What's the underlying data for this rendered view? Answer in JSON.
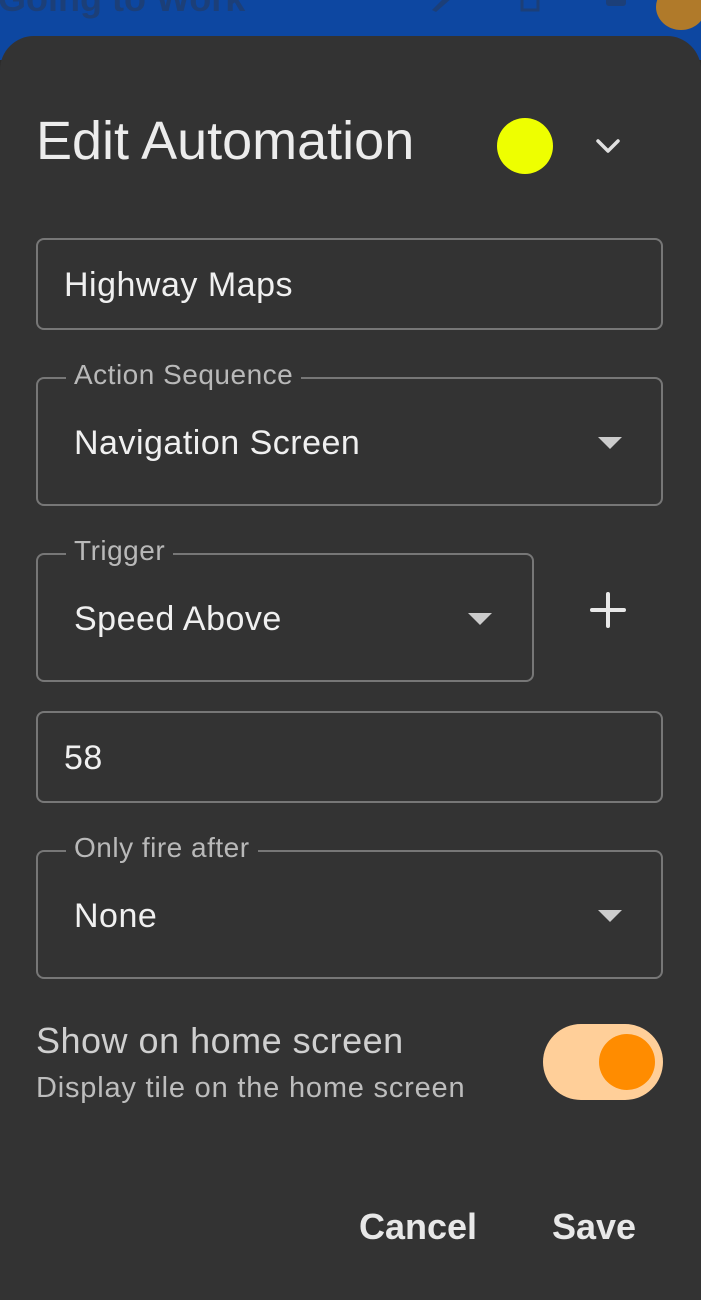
{
  "appbar": {
    "title": "Going to Work"
  },
  "dialog": {
    "title": "Edit Automation",
    "color": "#eeff00"
  },
  "name_field": {
    "value": "Highway Maps"
  },
  "action_sequence": {
    "label": "Action Sequence",
    "value": "Navigation Screen"
  },
  "trigger": {
    "label": "Trigger",
    "value": "Speed Above"
  },
  "trigger_value": {
    "value": "58"
  },
  "only_fire_after": {
    "label": "Only fire after",
    "value": "None"
  },
  "home_screen": {
    "title": "Show on home screen",
    "subtitle": "Display tile on the home screen",
    "enabled": true
  },
  "actions": {
    "cancel_label": "Cancel",
    "save_label": "Save"
  },
  "colors": {
    "accent": "#ff8c00",
    "switch_track": "#ffcf99",
    "appbar": "#0d47a1"
  }
}
